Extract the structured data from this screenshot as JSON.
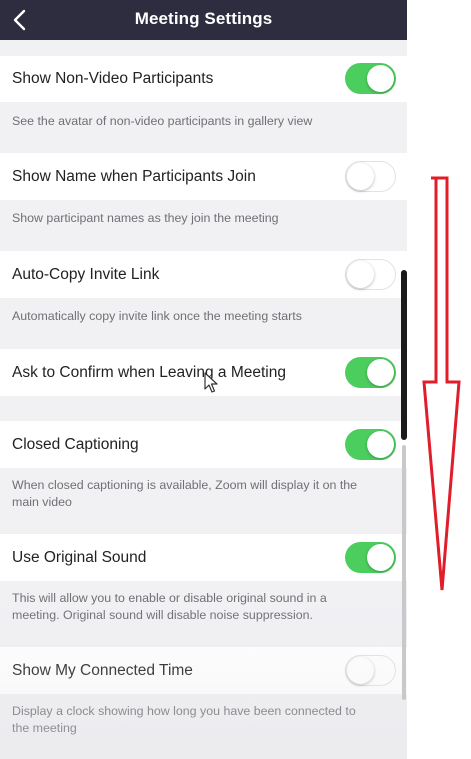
{
  "header": {
    "title": "Meeting Settings",
    "back_icon": "chevron-left-icon"
  },
  "settings": [
    {
      "label": "Show Non-Video Participants",
      "enabled": true,
      "description": "See the avatar of non-video participants in gallery view"
    },
    {
      "label": "Show Name when Participants Join",
      "enabled": false,
      "description": "Show participant names as they join the meeting"
    },
    {
      "label": "Auto-Copy Invite Link",
      "enabled": false,
      "description": "Automatically copy invite link once the meeting starts"
    },
    {
      "label": "Ask to Confirm when Leaving a Meeting",
      "enabled": true,
      "description": ""
    },
    {
      "label": "Closed Captioning",
      "enabled": true,
      "description": "When closed captioning is available, Zoom will display it on the main video"
    },
    {
      "label": "Use Original Sound",
      "enabled": true,
      "description": "This will allow you to enable or disable original sound in a meeting. Original sound will disable noise suppression."
    },
    {
      "label": "Show My Connected Time",
      "enabled": false,
      "description": "Display a clock showing how long you have been connected to the meeting"
    }
  ],
  "colors": {
    "header_bg": "#2d2d3f",
    "toggle_on": "#4cce5e",
    "annotation_arrow": "#e11d2a"
  }
}
